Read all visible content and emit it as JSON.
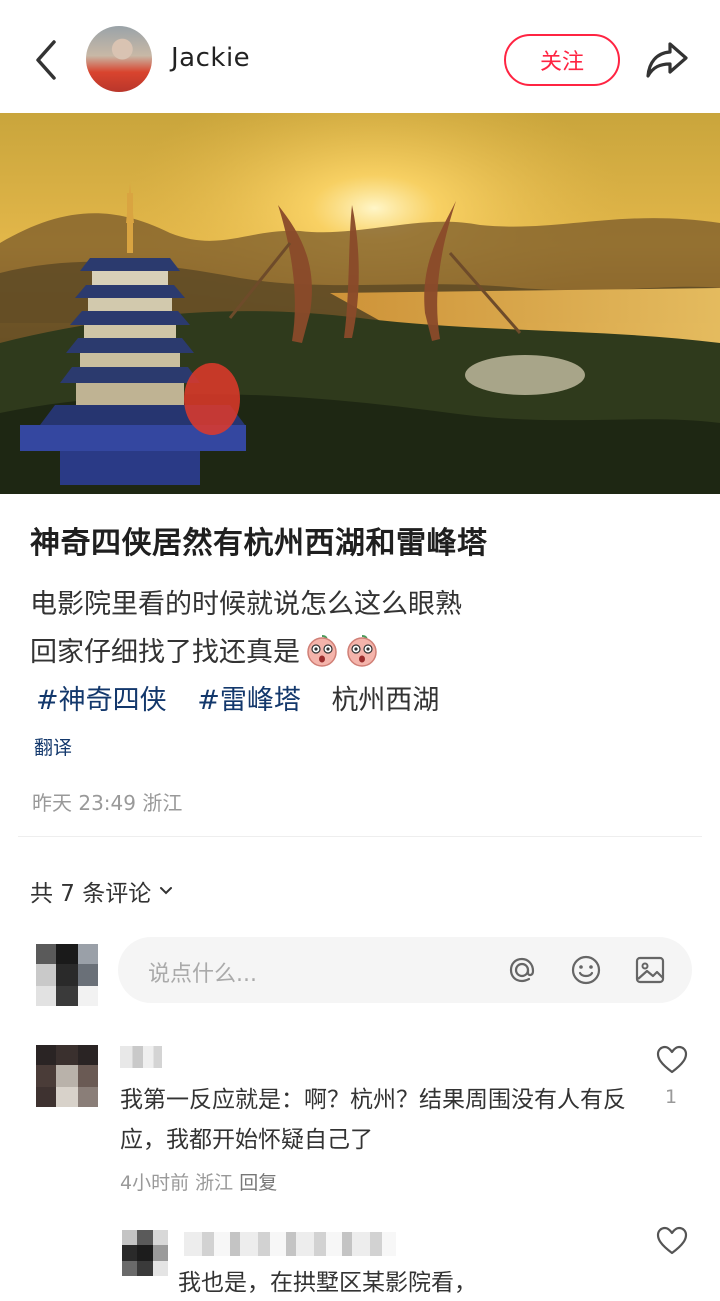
{
  "header": {
    "author_name": "Jackie",
    "follow_label": "关注",
    "icons": [
      "back-chevron-icon",
      "share-arrow-icon"
    ]
  },
  "post": {
    "title": "神奇四侠居然有杭州西湖和雷峰塔",
    "line1": "电影院里看的时候就说怎么这么眼熟",
    "line2": "回家仔细找了找还真是",
    "tags": [
      "#神奇四侠",
      "#雷峰塔"
    ],
    "plain_tag": "杭州西湖",
    "translate_label": "翻译",
    "meta": "昨天 23:49 浙江"
  },
  "comments_section": {
    "count_label": "共 7 条评论",
    "input_placeholder": "说点什么...",
    "input_icons": [
      "at-icon",
      "emoji-icon",
      "image-icon"
    ]
  },
  "comments": [
    {
      "text": "我第一反应就是：啊？杭州？结果周围没有人有反应，我都开始怀疑自己了",
      "time_location": "4小时前 浙江",
      "reply_label": "回复",
      "likes": "1"
    }
  ],
  "reply": {
    "text": "我也是，在拱墅区某影院看，"
  },
  "colors": {
    "accent": "#ff2442",
    "tag_blue": "#13386c"
  }
}
